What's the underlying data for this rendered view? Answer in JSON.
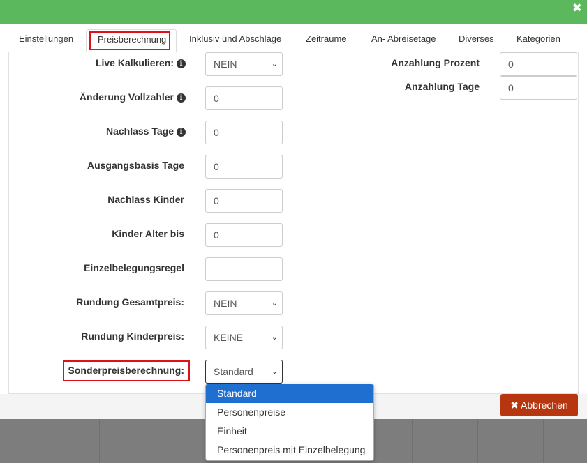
{
  "header": {
    "close_label": "✖"
  },
  "tabs": [
    {
      "label": "Einstellungen"
    },
    {
      "label": "Preisberechnung"
    },
    {
      "label": "Inklusiv und Abschläge"
    },
    {
      "label": "Zeiträume"
    },
    {
      "label": "An- Abreisetage"
    },
    {
      "label": "Diverses"
    },
    {
      "label": "Kategorien"
    }
  ],
  "form": {
    "live_kalkulieren": {
      "label": "Live Kalkulieren:",
      "value": "NEIN"
    },
    "aenderung_vollzahler": {
      "label": "Änderung Vollzahler",
      "value": "0"
    },
    "nachlass_tage": {
      "label": "Nachlass Tage",
      "value": "0"
    },
    "ausgangsbasis_tage": {
      "label": "Ausgangsbasis Tage",
      "value": "0"
    },
    "nachlass_kinder": {
      "label": "Nachlass Kinder",
      "value": "0"
    },
    "kinder_alter_bis": {
      "label": "Kinder Alter bis",
      "value": "0"
    },
    "einzelbelegungsregel": {
      "label": "Einzelbelegungsregel",
      "value": ""
    },
    "rundung_gesamtpreis": {
      "label": "Rundung Gesamtpreis:",
      "value": "NEIN"
    },
    "rundung_kinderpreis": {
      "label": "Rundung Kinderpreis:",
      "value": "KEINE"
    },
    "sonderpreisberechnung": {
      "label": "Sonderpreisberechnung:",
      "value": "Standard"
    },
    "anzahlung_prozent": {
      "label": "Anzahlung Prozent",
      "value": "0"
    },
    "anzahlung_tage": {
      "label": "Anzahlung Tage",
      "value": "0"
    }
  },
  "dropdown": {
    "options": [
      "Standard",
      "Personenpreise",
      "Einheit",
      "Personenpreis mit Einzelbelegung"
    ]
  },
  "footer": {
    "cancel_label": "✖ Abbrechen"
  },
  "colors": {
    "header": "#5cb85c",
    "cancel": "#b8360f",
    "highlight": "#e0101a",
    "selected_option": "#1f6fd1"
  },
  "icons": {
    "info": "info-circle-icon",
    "select": "chevron-down-icon"
  }
}
